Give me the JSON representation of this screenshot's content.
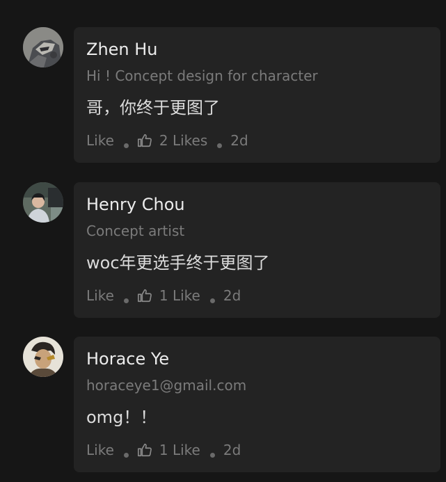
{
  "comments": [
    {
      "name": "Zhen Hu",
      "headline": "Hi ! Concept design for character",
      "body": "哥，你终于更图了",
      "like_label": "Like",
      "likes_count": "2 Likes",
      "time": "2d",
      "avatar_icon": "armored-robot-avatar"
    },
    {
      "name": "Henry Chou",
      "headline": "Concept artist",
      "body": "woc年更选手终于更图了",
      "like_label": "Like",
      "likes_count": "1 Like",
      "time": "2d",
      "avatar_icon": "person-outdoor-avatar"
    },
    {
      "name": "Horace Ye",
      "headline": "horaceye1@gmail.com",
      "body": "omg！！",
      "like_label": "Like",
      "likes_count": "1 Like",
      "time": "2d",
      "avatar_icon": "illustrated-warrior-avatar"
    }
  ],
  "colors": {
    "page_bg": "#161616",
    "card_bg": "#232323",
    "name_text": "#ececec",
    "muted_text": "#7b7b7b",
    "body_text": "#dcdcdc"
  }
}
